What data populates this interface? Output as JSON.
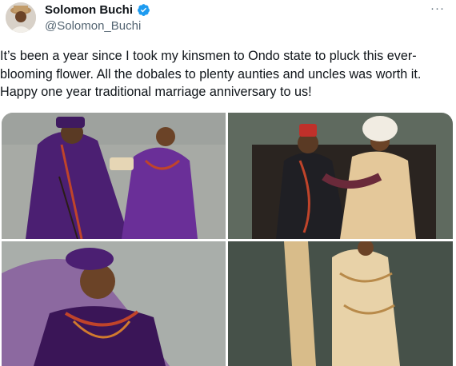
{
  "author": {
    "display_name": "Solomon Buchi",
    "handle": "@Solomon_Buchi",
    "verified": true,
    "avatar_icon": "avatar-photo"
  },
  "more_label": "···",
  "tweet": {
    "text": "It’s been a year since I took my kinsmen to Ondo state to pluck this ever-blooming flower. All the dobales to plenty aunties and uncles was worth it. Happy one year traditional marriage anniversary to us!"
  },
  "media": {
    "count": 4,
    "photos": [
      {
        "name": "photo-couple-purple"
      },
      {
        "name": "photo-couple-seated"
      },
      {
        "name": "photo-bride-veil"
      },
      {
        "name": "photo-bride-gown"
      }
    ]
  },
  "colors": {
    "verified": "#1d9bf0",
    "text": "#0f1419",
    "muted": "#536471",
    "purple_attire": "#4b1f72",
    "gold_attire": "#d9b98a"
  }
}
